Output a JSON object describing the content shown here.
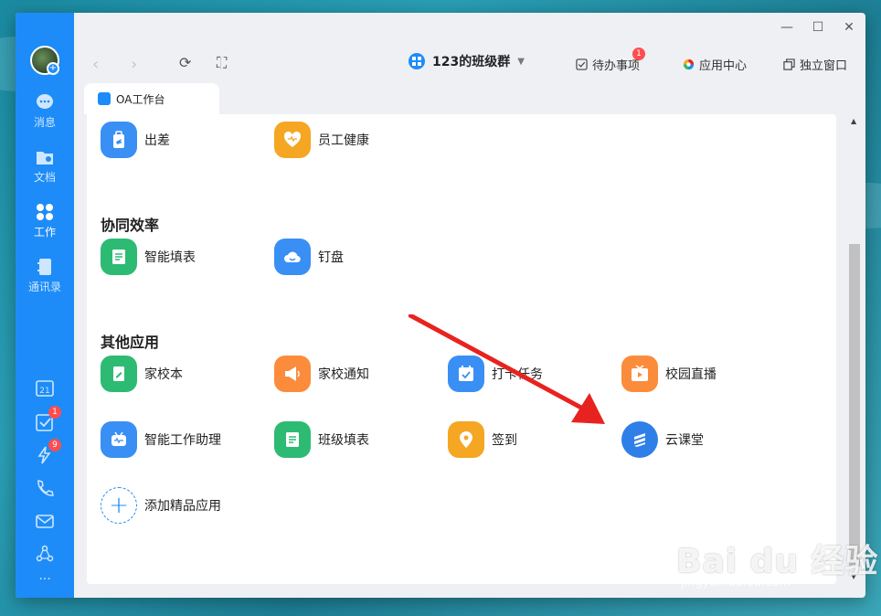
{
  "colors": {
    "accent": "#1d8cf8",
    "badge": "#ff4d4f",
    "arrow": "#e8231f"
  },
  "window": {
    "min": "—",
    "max": "☐",
    "close": "✕"
  },
  "rail": {
    "items": [
      {
        "label": "消息",
        "icon": "chat-bubble-icon"
      },
      {
        "label": "文档",
        "icon": "folder-icon"
      },
      {
        "label": "工作",
        "icon": "grid-icon",
        "active": true
      },
      {
        "label": "通讯录",
        "icon": "contacts-book-icon"
      }
    ],
    "calendar_day": "21",
    "todo_badge": "1",
    "ding_badge": "9",
    "more": "···"
  },
  "topbar": {
    "group_title": "123的班级群",
    "todo_label": "待办事项",
    "todo_badge": "1",
    "app_center_label": "应用中心",
    "standalone_label": "独立窗口"
  },
  "tab": {
    "label": "OA工作台"
  },
  "sections": {
    "collab": "协同效率",
    "other": "其他应用"
  },
  "apps": {
    "travel": "出差",
    "health": "员工健康",
    "smart_form": "智能填表",
    "dingpan": "钉盘",
    "home_school_book": "家校本",
    "home_school_notice": "家校通知",
    "checkin_task": "打卡任务",
    "campus_live": "校园直播",
    "smart_assistant": "智能工作助理",
    "class_form": "班级填表",
    "signin": "签到",
    "cloud_class": "云课堂",
    "add_app": "添加精品应用"
  },
  "watermark": {
    "brand": "Bai du 经验",
    "url": "jingyan.baidu.com"
  }
}
